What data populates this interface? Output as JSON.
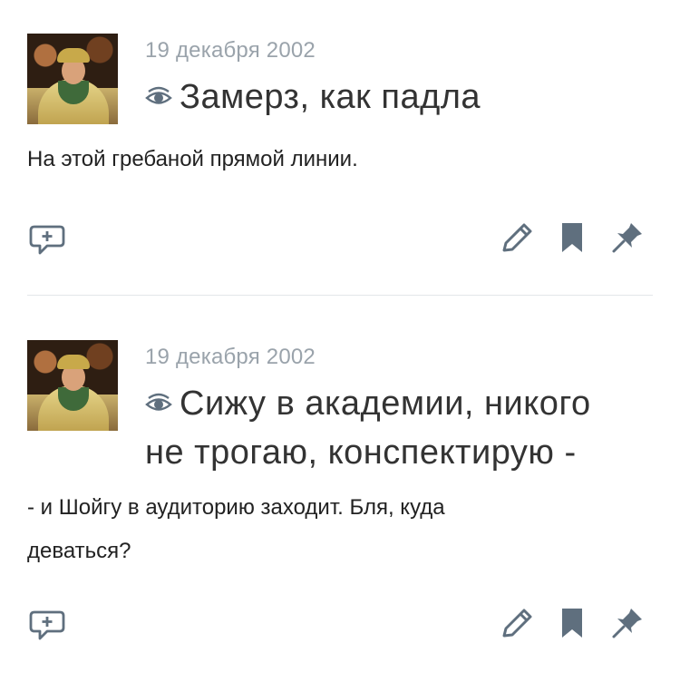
{
  "posts": [
    {
      "date": "19 декабря 2002",
      "title": "Замерз, как падла",
      "body": "На этой гребаной прямой линии."
    },
    {
      "date": "19 декабря 2002",
      "title_line1": "Сижу в академии, никого",
      "title_line2": "не трогаю, конспектирую -",
      "body_line1": "- и Шойгу в аудиторию заходит. Бля, куда",
      "body_line2": "деваться?"
    }
  ],
  "icons": {
    "visibility": "eye-icon",
    "comment": "comment-add-icon",
    "edit": "pencil-icon",
    "bookmark": "bookmark-icon",
    "pin": "pin-icon"
  },
  "colors": {
    "icon": "#5f6f7e",
    "date": "#9aa3ab",
    "divider": "#e3e6e9"
  }
}
